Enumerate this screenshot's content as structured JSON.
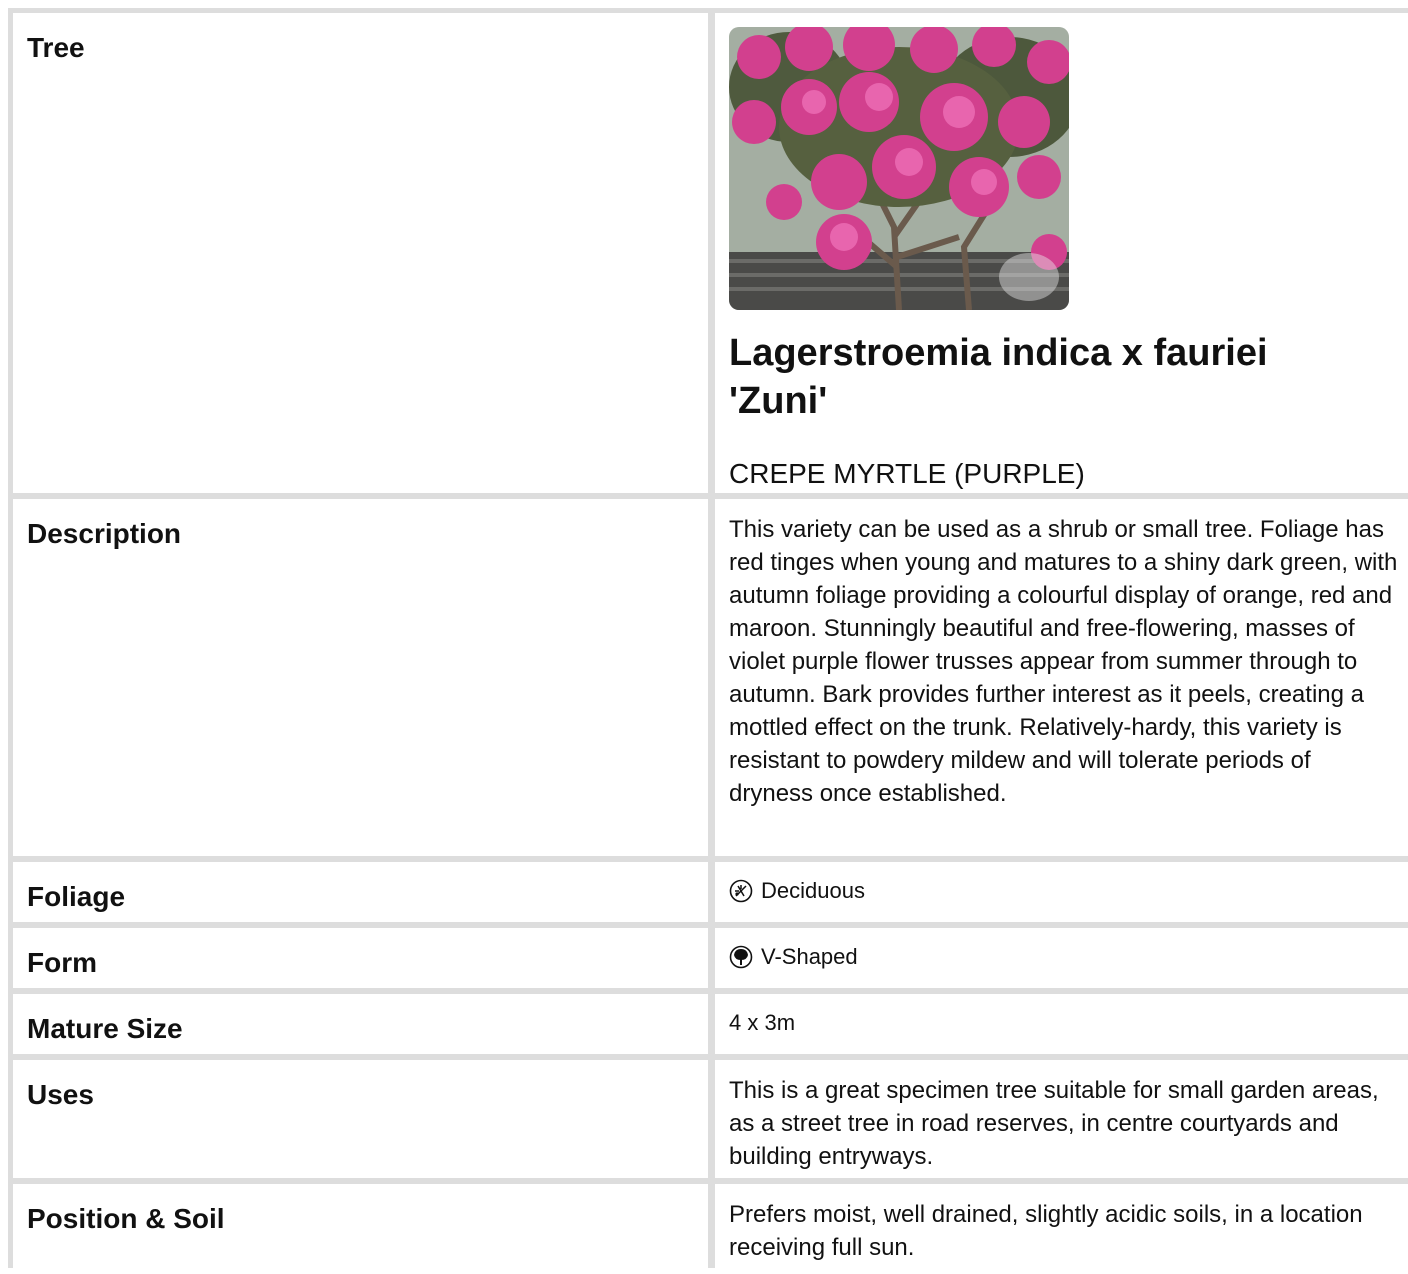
{
  "rows": {
    "tree": {
      "label": "Tree",
      "image_alt": "Pink crepe myrtle flowers",
      "scientific_name": "Lagerstroemia indica x fauriei 'Zuni'",
      "common_name": "CREPE MYRTLE (PURPLE)"
    },
    "description": {
      "label": "Description",
      "value": "This variety can be used as a shrub or small tree. Foliage has red tinges when young and matures to a shiny dark green, with autumn foliage providing a colourful display of orange, red and maroon. Stunningly beautiful and free-flowering, masses of violet purple flower trusses appear from summer through to autumn. Bark provides further interest as it peels, creating a mottled effect on the trunk. Relatively-hardy, this variety is resistant to powdery mildew and will tolerate periods of dryness once established."
    },
    "foliage": {
      "label": "Foliage",
      "value": "Deciduous",
      "icon": "deciduous-leaf-icon"
    },
    "form": {
      "label": "Form",
      "value": "V-Shaped",
      "icon": "v-shaped-tree-icon"
    },
    "mature_size": {
      "label": "Mature Size",
      "value": "4 x 3m"
    },
    "uses": {
      "label": "Uses",
      "value": "This is a great specimen tree suitable for small garden areas, as a street tree in road reserves, in centre courtyards and building entryways."
    },
    "position_soil": {
      "label": "Position & Soil",
      "value": "Prefers moist, well drained, slightly acidic soils, in a location receiving full sun."
    }
  }
}
